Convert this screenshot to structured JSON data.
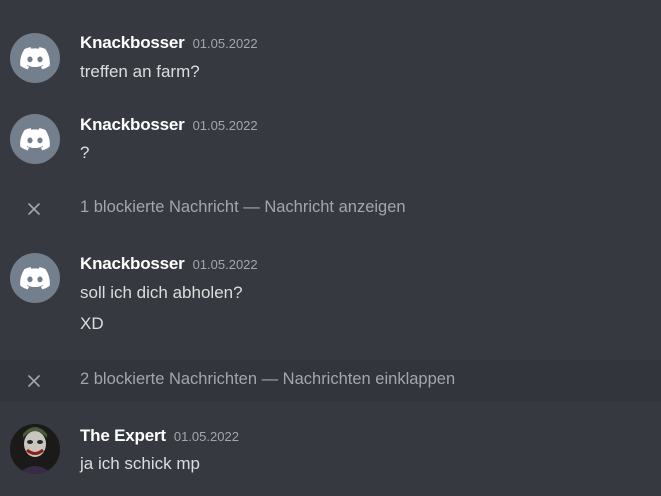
{
  "messages": [
    {
      "username": "Knackbosser",
      "timestamp": "01.05.2022",
      "lines": [
        "treffen an farm?"
      ],
      "avatar": "discord-logo-icon"
    },
    {
      "username": "Knackbosser",
      "timestamp": "01.05.2022",
      "lines": [
        "?"
      ],
      "avatar": "discord-logo-icon"
    },
    {
      "username": "Knackbosser",
      "timestamp": "01.05.2022",
      "lines": [
        "soll ich dich abholen?",
        "XD"
      ],
      "avatar": "discord-logo-icon"
    },
    {
      "username": "The Expert",
      "timestamp": "01.05.2022",
      "lines": [
        "ja ich schick mp"
      ],
      "avatar": "joker-avatar"
    }
  ],
  "blocked": [
    {
      "text": "1 blockierte Nachricht — Nachricht anzeigen"
    },
    {
      "text": "2 blockierte Nachrichten — Nachrichten einklappen"
    }
  ],
  "colors": {
    "background": "#36393f",
    "username": "#ffffff",
    "message_text": "#dcddde",
    "muted": "#a3a6aa",
    "avatar_bg": "#747f8d"
  }
}
